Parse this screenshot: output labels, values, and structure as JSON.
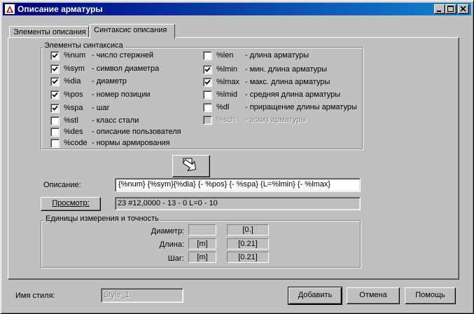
{
  "window": {
    "title": "Описание арматуры",
    "minimize_icon": "minimize-icon",
    "maximize_icon": "maximize-icon",
    "close_icon": "close-icon"
  },
  "tabs": [
    {
      "label": "Элементы описания",
      "active": false
    },
    {
      "label": "Синтаксис описания",
      "active": true
    }
  ],
  "syntax_group": {
    "title": "Элементы синтаксиса",
    "left": [
      {
        "code": "%num",
        "desc": "- число стержней",
        "checked": true,
        "enabled": true
      },
      {
        "code": "%sym",
        "desc": "- символ диаметра",
        "checked": true,
        "enabled": true
      },
      {
        "code": "%dia",
        "desc": "- диаметр",
        "checked": true,
        "enabled": true
      },
      {
        "code": "%pos",
        "desc": "- номер позиции",
        "checked": true,
        "enabled": true
      },
      {
        "code": "%spa",
        "desc": "- шаг",
        "checked": true,
        "enabled": true
      },
      {
        "code": "%stl",
        "desc": "- класс стали",
        "checked": false,
        "enabled": true
      },
      {
        "code": "%des",
        "desc": "- описание пользователя",
        "checked": false,
        "enabled": true
      },
      {
        "code": "%code",
        "desc": "- нормы армирования",
        "checked": false,
        "enabled": true
      }
    ],
    "right": [
      {
        "code": "%len",
        "desc": "- длина арматуры",
        "checked": false,
        "enabled": true
      },
      {
        "code": "%lmin",
        "desc": "- мин. длина арматуры",
        "checked": true,
        "enabled": true
      },
      {
        "code": "%lmax",
        "desc": "- макс. длина арматуры",
        "checked": true,
        "enabled": true
      },
      {
        "code": "%lmid",
        "desc": "- средняя длина арматуры",
        "checked": false,
        "enabled": true
      },
      {
        "code": "%dl",
        "desc": "- приращение длины арматуры",
        "checked": false,
        "enabled": true
      },
      {
        "code": "%sch",
        "desc": "- эскиз арматуры",
        "checked": false,
        "enabled": false
      }
    ]
  },
  "insert_button": {
    "icon": "insert-arrow-icon"
  },
  "description": {
    "label": "Описание:",
    "value": "{%num} {%sym}{%dia} {- %pos} {- %spa}  {L=%lmin} {- %lmax}"
  },
  "preview": {
    "button_label": "Просмотр:",
    "value": "23 #12,0000 - 13 - 0  L=0 - 10"
  },
  "units_group": {
    "title": "Единицы измерения и точность",
    "rows": [
      {
        "label": "Диаметр:",
        "unit": "",
        "precision": "[0.]"
      },
      {
        "label": "Длина:",
        "unit": "[m]",
        "precision": "[0.21]"
      },
      {
        "label": "Шаг:",
        "unit": "[m]",
        "precision": "[0.21]"
      }
    ]
  },
  "style": {
    "label": "Имя стиля:",
    "value": "Style_1"
  },
  "buttons": {
    "add": "Добавить",
    "cancel": "Отмена",
    "help": "Помощь"
  },
  "colors": {
    "title_start": "#000080",
    "title_end": "#1084d0",
    "face": "#c0c0c0"
  }
}
